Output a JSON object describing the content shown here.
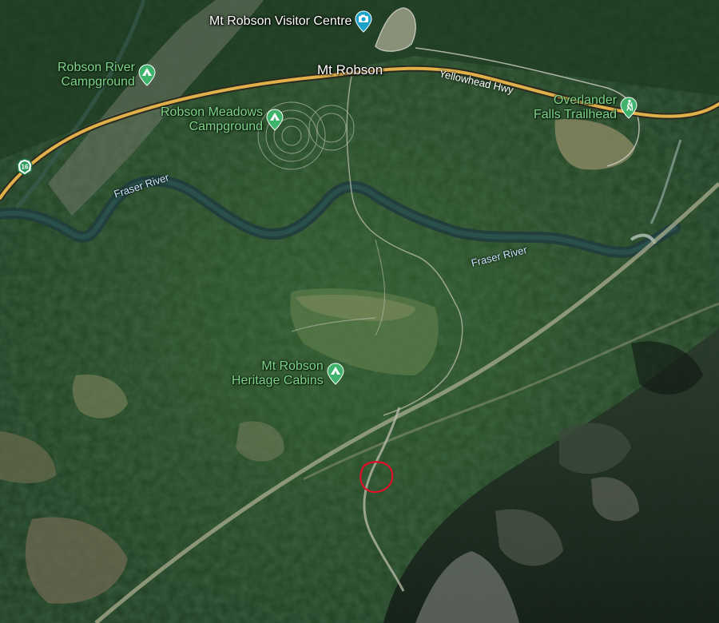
{
  "map": {
    "type": "satellite",
    "colors": {
      "campground_pin": "#3fb36b",
      "trail_pin": "#3fb36b",
      "visitor_pin": "#1aa3c9",
      "highway": "#e0b04a",
      "river": "#254a45",
      "markup_circle": "#e0102a"
    },
    "places": [
      {
        "label": "Mt Robson"
      }
    ],
    "pois": [
      {
        "id": "visitor-centre",
        "label": "Mt Robson Visitor Centre",
        "icon": "camera-icon"
      },
      {
        "id": "robson-river-campground",
        "label": "Robson River\nCampground",
        "icon": "campground-icon"
      },
      {
        "id": "robson-meadows-campground",
        "label": "Robson Meadows\nCampground",
        "icon": "campground-icon"
      },
      {
        "id": "overlander-falls-trailhead",
        "label": "Overlander\nFalls Trailhead",
        "icon": "hiker-icon"
      },
      {
        "id": "heritage-cabins",
        "label": "Mt Robson\nHeritage Cabins",
        "icon": "campground-icon"
      }
    ],
    "roads": [
      {
        "label": "Yellowhead Hwy"
      }
    ],
    "rivers": [
      {
        "label": "Fraser River"
      },
      {
        "label": "Fraser River"
      }
    ],
    "highway_shield": {
      "label": "16",
      "icon": "highway-shield-icon"
    }
  }
}
